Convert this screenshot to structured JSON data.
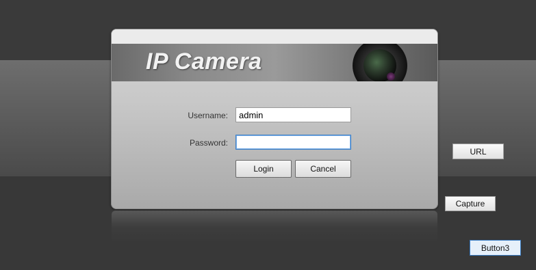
{
  "banner": {
    "title": "IP Camera"
  },
  "login": {
    "username_label": "Username:",
    "username_value": "admin",
    "password_label": "Password:",
    "password_value": "",
    "login_button": "Login",
    "cancel_button": "Cancel"
  },
  "side_buttons": {
    "url": "URL",
    "capture": "Capture",
    "button3": "Button3"
  },
  "colors": {
    "background": "#383838",
    "focus_border": "#3c7fc7"
  },
  "icons": {
    "banner_graphic": "camera-lens-icon"
  }
}
